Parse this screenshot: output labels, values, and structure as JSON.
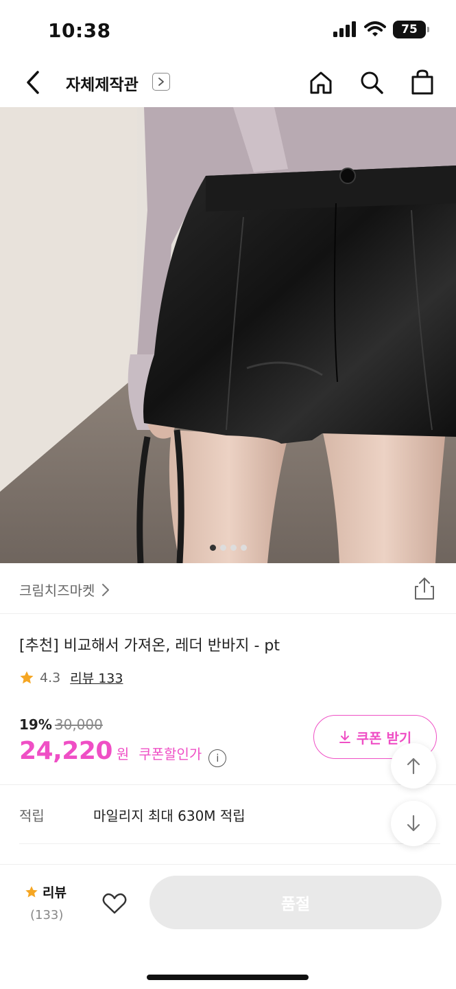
{
  "status_bar": {
    "time": "10:38",
    "battery": "75"
  },
  "nav": {
    "title": "자체제작관",
    "icons": [
      "back-icon",
      "chevron-right-icon",
      "home-icon",
      "search-icon",
      "shopping-bag-icon"
    ]
  },
  "gallery": {
    "page_count": 4,
    "current_page": 1
  },
  "store": {
    "name": "크림치즈마켓"
  },
  "product": {
    "title": "[추천] 비교해서 가져온, 레더 반바지 - pt",
    "rating": "4.3",
    "review_label": "리뷰 133"
  },
  "price": {
    "discount": "19%",
    "original": "30,000",
    "sale": "24,220",
    "unit": "원",
    "label": "쿠폰할인가",
    "info_icon": "i"
  },
  "coupon": {
    "label": "쿠폰 받기"
  },
  "mileage": {
    "label": "적립",
    "text": "마일리지 최대 630M 적립"
  },
  "bottom": {
    "review_label": "리뷰",
    "review_count": "(133)",
    "soldout_label": "품절"
  },
  "colors": {
    "accent": "#ef4fc5",
    "star": "#f5a623",
    "disabled": "#e9e9e9"
  }
}
